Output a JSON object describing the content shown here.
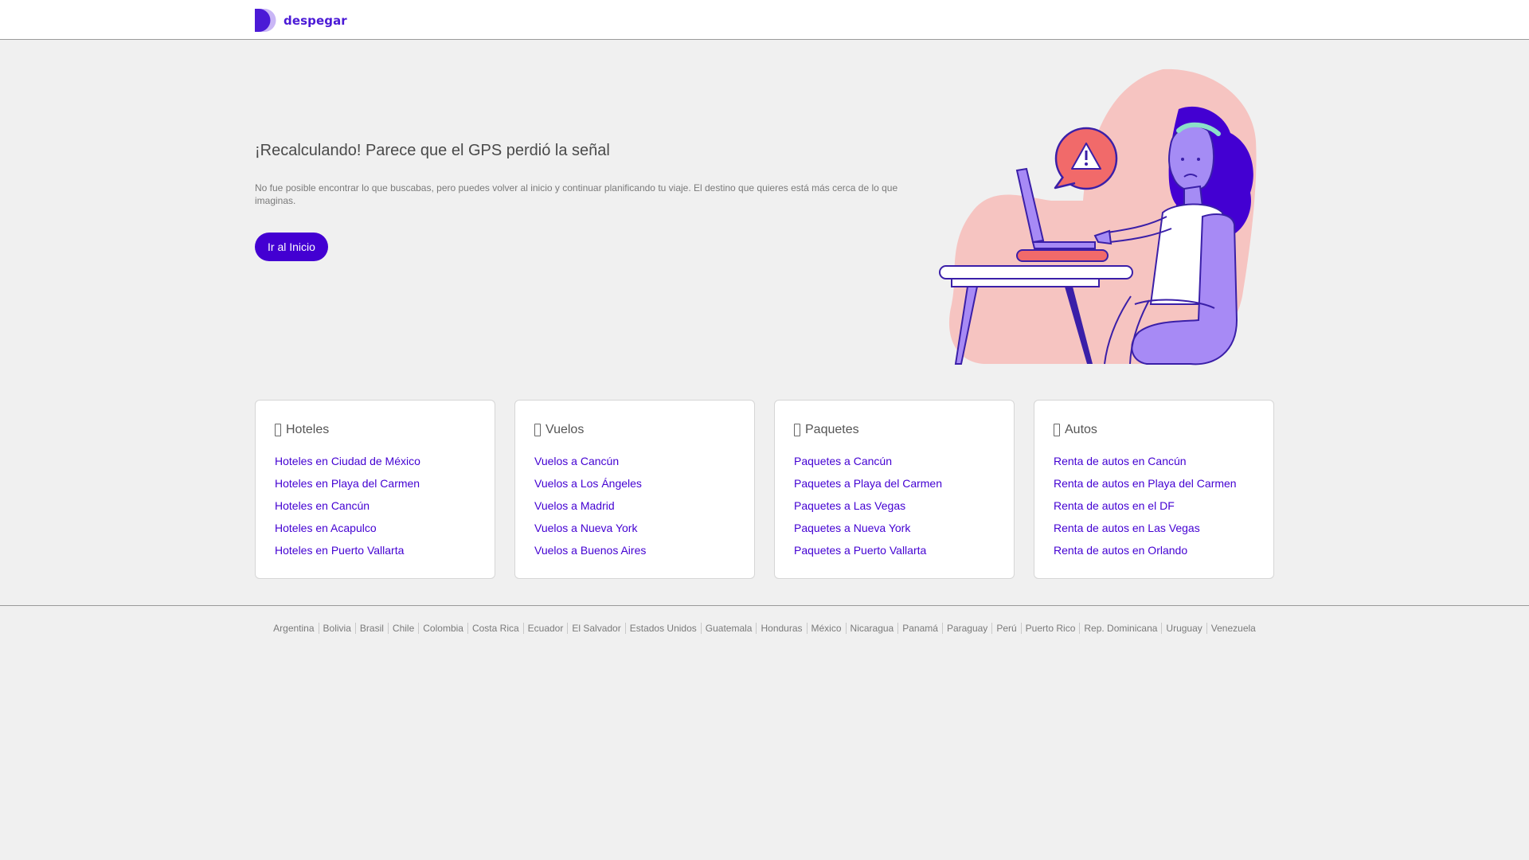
{
  "header": {
    "logo_text": "despegar",
    "brand_color": "#4b1ad6"
  },
  "hero": {
    "title": "¡Recalculando! Parece que el GPS perdió la señal",
    "description": "No fue posible encontrar lo que buscabas, pero puedes volver al inicio y continuar planificando tu viaje. El destino que quieres está más cerca de lo que imaginas.",
    "button_label": "Ir al Inicio",
    "button_color": "#4300d2"
  },
  "cards": [
    {
      "title": "Hoteles",
      "icon": "bed-icon",
      "links": [
        "Hoteles en Ciudad de México",
        "Hoteles en Playa del Carmen",
        "Hoteles en Cancún",
        "Hoteles en Acapulco",
        "Hoteles en Puerto Vallarta"
      ]
    },
    {
      "title": "Vuelos",
      "icon": "plane-icon",
      "links": [
        "Vuelos a Cancún",
        "Vuelos a Los Ángeles",
        "Vuelos a Madrid",
        "Vuelos a Nueva York",
        "Vuelos a Buenos Aires"
      ]
    },
    {
      "title": "Paquetes",
      "icon": "package-icon",
      "links": [
        "Paquetes a Cancún",
        "Paquetes a Playa del Carmen",
        "Paquetes a Las Vegas",
        "Paquetes a Nueva York",
        "Paquetes a Puerto Vallarta"
      ]
    },
    {
      "title": "Autos",
      "icon": "car-icon",
      "links": [
        "Renta de autos en Cancún",
        "Renta de autos en Playa del Carmen",
        "Renta de autos en el DF",
        "Renta de autos en Las Vegas",
        "Renta de autos en Orlando"
      ]
    }
  ],
  "footer": {
    "countries": [
      "Argentina",
      "Bolivia",
      "Brasil",
      "Chile",
      "Colombia",
      "Costa Rica",
      "Ecuador",
      "El Salvador",
      "Estados Unidos",
      "Guatemala",
      "Honduras",
      "México",
      "Nicaragua",
      "Panamá",
      "Paraguay",
      "Perú",
      "Puerto Rico",
      "Rep. Dominicana",
      "Uruguay",
      "Venezuela"
    ]
  }
}
